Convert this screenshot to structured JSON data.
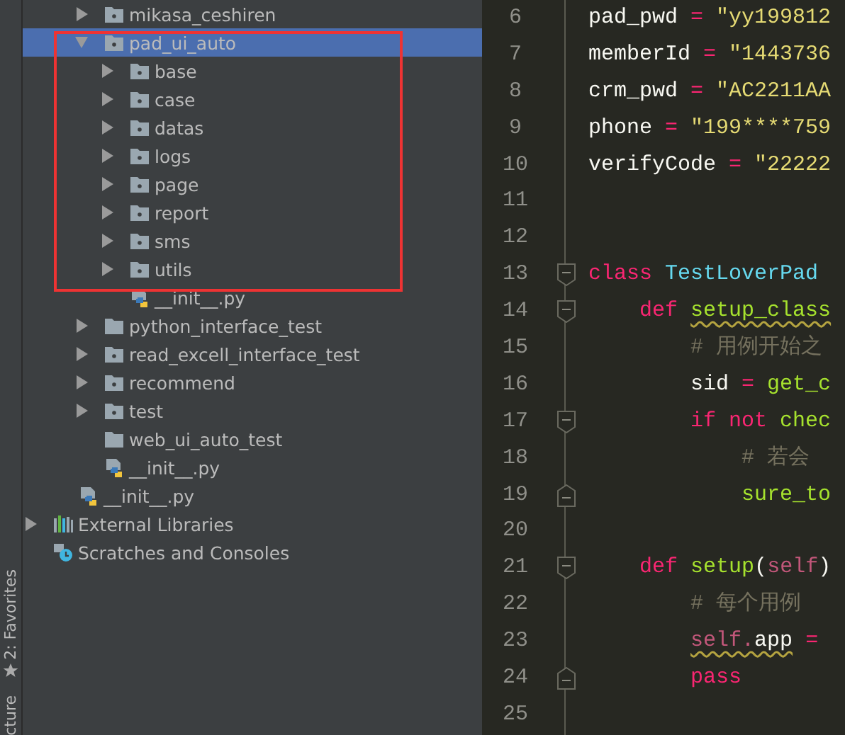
{
  "tool_strip": [
    {
      "label": "2: Favorites",
      "kind": "star"
    },
    {
      "label": "cture"
    }
  ],
  "tree": [
    {
      "children": [
        {
          "children": [
            {
              "label": "mikasa_ceshiren",
              "kind": "package",
              "expanded": false,
              "selected": false
            },
            {
              "label": "pad_ui_auto",
              "kind": "package",
              "expanded": true,
              "selected": true,
              "children": [
                {
                  "label": "base",
                  "kind": "package",
                  "expanded": false,
                  "selected": false
                },
                {
                  "label": "case",
                  "kind": "package",
                  "expanded": false,
                  "selected": false
                },
                {
                  "label": "datas",
                  "kind": "package",
                  "expanded": false,
                  "selected": false
                },
                {
                  "label": "logs",
                  "kind": "package",
                  "expanded": false,
                  "selected": false
                },
                {
                  "label": "page",
                  "kind": "package",
                  "expanded": false,
                  "selected": false
                },
                {
                  "label": "report",
                  "kind": "package",
                  "expanded": false,
                  "selected": false
                },
                {
                  "label": "sms",
                  "kind": "package",
                  "expanded": false,
                  "selected": false
                },
                {
                  "label": "utils",
                  "kind": "package",
                  "expanded": false,
                  "selected": false
                },
                {
                  "label": "__init__.py",
                  "kind": "python",
                  "selected": false
                }
              ]
            },
            {
              "label": "python_interface_test",
              "kind": "folder",
              "expanded": false,
              "selected": false
            },
            {
              "label": "read_excell_interface_test",
              "kind": "package",
              "expanded": false,
              "selected": false
            },
            {
              "label": "recommend",
              "kind": "package",
              "expanded": false,
              "selected": false
            },
            {
              "label": "test",
              "kind": "package",
              "expanded": false,
              "selected": false
            },
            {
              "label": "web_ui_auto_test",
              "kind": "folder",
              "selected": false
            },
            {
              "label": "__init__.py",
              "kind": "python",
              "selected": false
            }
          ]
        },
        {
          "label": "__init__.py",
          "kind": "python",
          "selected": false
        }
      ]
    },
    {
      "label": "External Libraries",
      "kind": "libraries",
      "expanded": false,
      "selected": false
    },
    {
      "label": "Scratches and Consoles",
      "kind": "scratches",
      "selected": false
    }
  ],
  "editor": {
    "lines": [
      {
        "number": "6",
        "tokens": [
          {
            "text": "pad_pwd ",
            "kind": "name"
          },
          {
            "text": "= ",
            "kind": "op"
          },
          {
            "text": "\"yy199812",
            "kind": "str"
          }
        ]
      },
      {
        "number": "7",
        "tokens": [
          {
            "text": "memberId ",
            "kind": "name"
          },
          {
            "text": "= ",
            "kind": "op"
          },
          {
            "text": "\"1443736",
            "kind": "str"
          }
        ]
      },
      {
        "number": "8",
        "tokens": [
          {
            "text": "crm_pwd ",
            "kind": "name"
          },
          {
            "text": "= ",
            "kind": "op"
          },
          {
            "text": "\"AC2211AA",
            "kind": "str"
          }
        ]
      },
      {
        "number": "9",
        "tokens": [
          {
            "text": "phone ",
            "kind": "name"
          },
          {
            "text": "= ",
            "kind": "op"
          },
          {
            "text": "\"199****759",
            "kind": "str"
          }
        ]
      },
      {
        "number": "10",
        "tokens": [
          {
            "text": "verifyCode ",
            "kind": "name"
          },
          {
            "text": "= ",
            "kind": "op"
          },
          {
            "text": "\"22222",
            "kind": "str"
          }
        ]
      },
      {
        "number": "11"
      },
      {
        "number": "12"
      },
      {
        "number": "13",
        "kind": "fold-start",
        "tokens": [
          {
            "text": "class ",
            "kind": "keyword"
          },
          {
            "text": "TestLoverPad",
            "kind": "classname"
          }
        ]
      },
      {
        "number": "14",
        "kind": "fold-start",
        "tokens": [
          {
            "text": "    def ",
            "kind": "keyword"
          },
          {
            "text": "setup_class",
            "kind": "function",
            "underline": true
          }
        ]
      },
      {
        "number": "15",
        "tokens": [
          {
            "text": "        # 用例开始之",
            "kind": "comment"
          }
        ]
      },
      {
        "number": "16",
        "tokens": [
          {
            "text": "        sid ",
            "kind": "name"
          },
          {
            "text": "= ",
            "kind": "op"
          },
          {
            "text": "get_c",
            "kind": "function"
          }
        ]
      },
      {
        "number": "17",
        "kind": "fold-start",
        "tokens": [
          {
            "text": "        if not ",
            "kind": "keyword"
          },
          {
            "text": "chec",
            "kind": "function"
          }
        ]
      },
      {
        "number": "18",
        "tokens": [
          {
            "text": "            # 若会",
            "kind": "comment"
          }
        ]
      },
      {
        "number": "19",
        "kind": "fold-end",
        "tokens": [
          {
            "text": "            sure_to",
            "kind": "function"
          }
        ]
      },
      {
        "number": "20"
      },
      {
        "number": "21",
        "kind": "fold-start",
        "tokens": [
          {
            "text": "    def ",
            "kind": "keyword"
          },
          {
            "text": "setup",
            "kind": "function"
          },
          {
            "text": "(",
            "kind": "name"
          },
          {
            "text": "self",
            "kind": "self"
          },
          {
            "text": ")",
            "kind": "name"
          }
        ]
      },
      {
        "number": "22",
        "tokens": [
          {
            "text": "        # 每个用例",
            "kind": "comment"
          }
        ]
      },
      {
        "number": "23",
        "tokens": [
          {
            "text": "        self.",
            "kind": "self",
            "underline": true
          },
          {
            "text": "app",
            "kind": "name",
            "underline": true
          },
          {
            "text": " =",
            "kind": "op"
          }
        ]
      },
      {
        "number": "24",
        "kind": "fold-end",
        "tokens": [
          {
            "text": "        pass",
            "kind": "keyword"
          }
        ]
      },
      {
        "number": "25"
      }
    ]
  }
}
